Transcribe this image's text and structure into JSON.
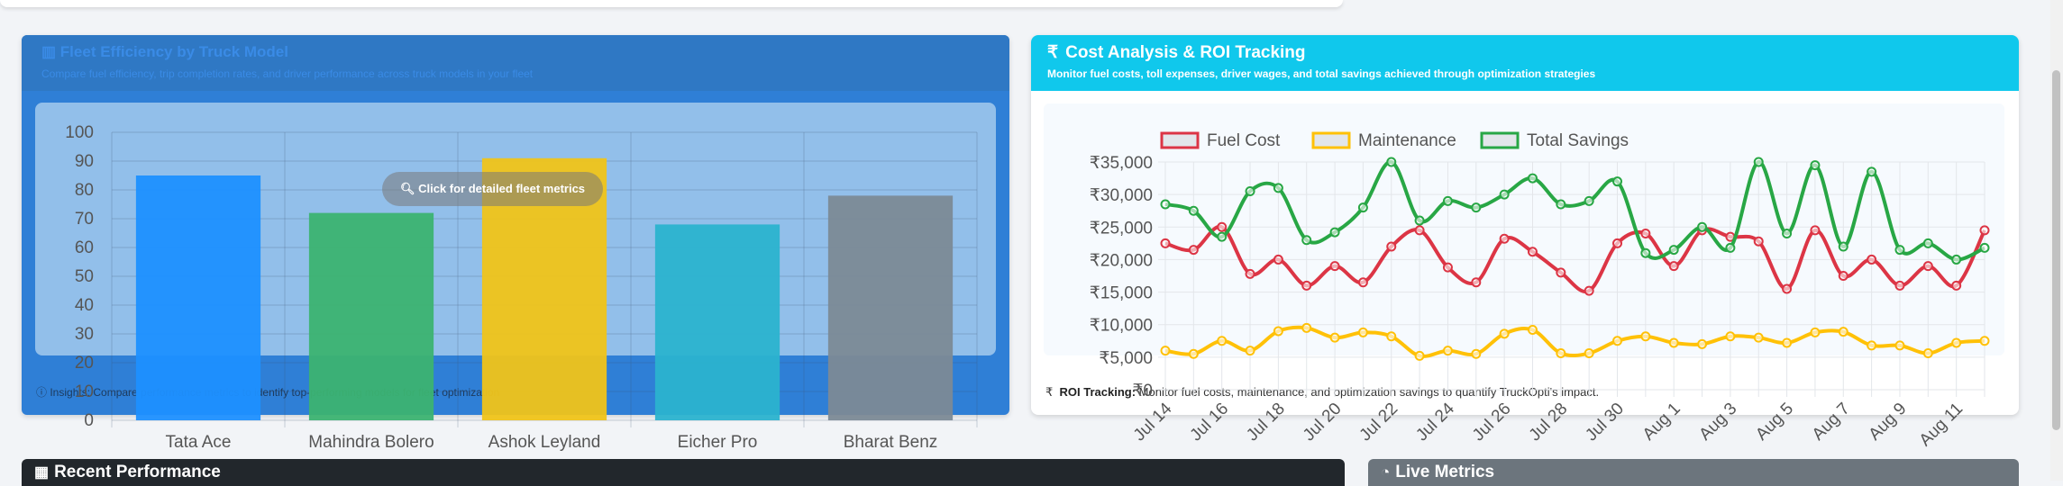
{
  "fleet": {
    "title": "Fleet Efficiency by Truck Model",
    "subtitle": "Compare fuel efficiency, trip completion rates, and driver performance across truck models in your fleet",
    "tooltip": "Click for detailed fleet metrics",
    "insights": "Insights: Compare performance metrics to identify top-performing models for fleet optimization",
    "chart_data": {
      "type": "bar",
      "categories": [
        "Tata Ace",
        "Mahindra Bolero",
        "Ashok Leyland",
        "Eicher Pro",
        "Bharat Benz"
      ],
      "values": [
        85,
        72,
        91,
        68,
        78
      ],
      "colors": [
        "#1e90ff",
        "#3cb371",
        "#f0c419",
        "#2bb3cf",
        "#7c8a96"
      ],
      "ylim": [
        0,
        100
      ],
      "yticks": [
        0,
        10,
        20,
        30,
        40,
        50,
        60,
        70,
        80,
        90,
        100
      ],
      "grid": true
    }
  },
  "cost": {
    "icon": "₹",
    "title": "Cost Analysis & ROI Tracking",
    "subtitle": "Monitor fuel costs, toll expenses, driver wages, and total savings achieved through optimization strategies",
    "footer_icon": "₹",
    "footer_bold": "ROI Tracking:",
    "footer_text": " Monitor fuel costs, maintenance, and optimization savings to quantify TruckOpti's impact.",
    "chart_data": {
      "type": "line",
      "x": [
        "Jul 14",
        "Jul 15",
        "Jul 16",
        "Jul 17",
        "Jul 18",
        "Jul 19",
        "Jul 20",
        "Jul 21",
        "Jul 22",
        "Jul 23",
        "Jul 24",
        "Jul 25",
        "Jul 26",
        "Jul 27",
        "Jul 28",
        "Jul 29",
        "Jul 30",
        "Jul 31",
        "Aug 1",
        "Aug 2",
        "Aug 3",
        "Aug 4",
        "Aug 5",
        "Aug 6",
        "Aug 7",
        "Aug 8",
        "Aug 9",
        "Aug 10",
        "Aug 11",
        "Aug 12"
      ],
      "xticks": [
        "Jul 14",
        "Jul 16",
        "Jul 18",
        "Jul 20",
        "Jul 22",
        "Jul 24",
        "Jul 26",
        "Jul 28",
        "Jul 30",
        "Aug 1",
        "Aug 3",
        "Aug 5",
        "Aug 7",
        "Aug 9",
        "Aug 11"
      ],
      "yticks": [
        "₹0",
        "₹5,000",
        "₹10,000",
        "₹15,000",
        "₹20,000",
        "₹25,000",
        "₹30,000",
        "₹35,000"
      ],
      "ylim": [
        0,
        35000
      ],
      "grid": true,
      "legend_position": "top",
      "series": [
        {
          "name": "Fuel Cost",
          "color": "#dc3545",
          "values": [
            22500,
            21500,
            25000,
            17800,
            20000,
            16000,
            19000,
            16500,
            22000,
            24500,
            18800,
            16500,
            23200,
            21200,
            18000,
            15200,
            22500,
            24000,
            19000,
            24500,
            23500,
            22800,
            15500,
            24500,
            17500,
            20000,
            16000,
            19000,
            16000,
            24500
          ]
        },
        {
          "name": "Maintenance",
          "color": "#ffc107",
          "values": [
            6000,
            5500,
            7500,
            6000,
            9000,
            9500,
            8000,
            8800,
            8200,
            5200,
            6000,
            5500,
            8600,
            9200,
            5600,
            5600,
            7500,
            8200,
            7200,
            7000,
            8200,
            8000,
            7200,
            8800,
            8900,
            6800,
            6800,
            5600,
            7200,
            7500
          ]
        },
        {
          "name": "Total Savings",
          "color": "#28a745",
          "values": [
            28500,
            27500,
            23500,
            30500,
            31000,
            23000,
            24200,
            28000,
            35000,
            26000,
            29000,
            28000,
            30000,
            32500,
            28500,
            29000,
            32000,
            21000,
            21500,
            25000,
            21800,
            35000,
            24000,
            34500,
            22000,
            33500,
            21500,
            22500,
            20000,
            21800
          ]
        }
      ]
    }
  },
  "recent": {
    "icon": "▦",
    "title": "Recent Performance"
  },
  "live": {
    "icon": "◔",
    "title": "Live Metrics"
  }
}
